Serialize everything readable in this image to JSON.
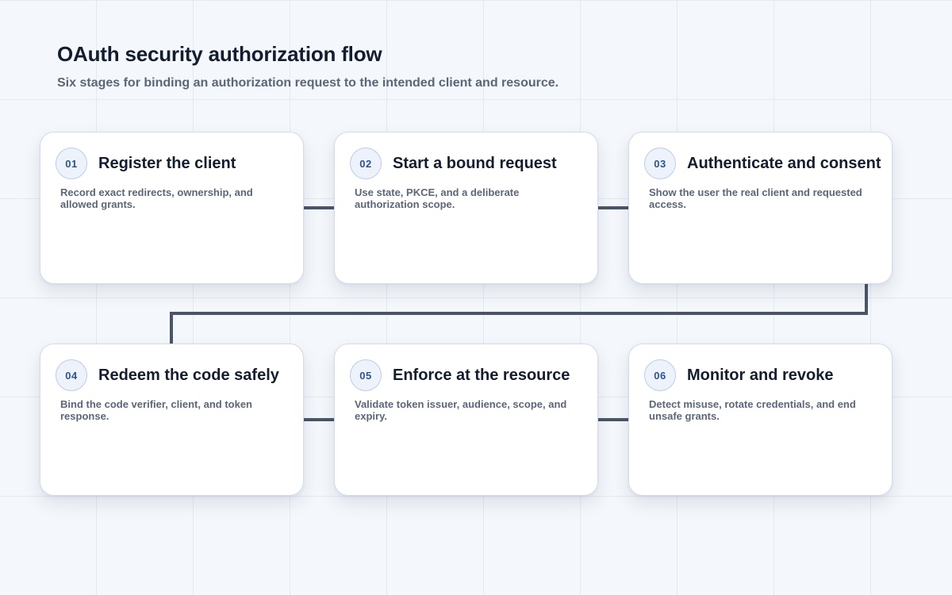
{
  "header": {
    "title": "OAuth security authorization flow",
    "subtitle": "Six stages for binding an authorization request to the intended client and resource."
  },
  "steps": [
    {
      "number": "01",
      "title": "Register the client",
      "description": "Record exact redirects, ownership, and allowed grants."
    },
    {
      "number": "02",
      "title": "Start a bound request",
      "description": "Use state, PKCE, and a deliberate authorization scope."
    },
    {
      "number": "03",
      "title": "Authenticate and consent",
      "description": "Show the user the real client and requested access."
    },
    {
      "number": "04",
      "title": "Redeem the code safely",
      "description": "Bind the code verifier, client, and token response."
    },
    {
      "number": "05",
      "title": "Enforce at the resource",
      "description": "Validate token issuer, audience, scope, and expiry."
    },
    {
      "number": "06",
      "title": "Monitor and revoke",
      "description": "Detect misuse, rotate credentials, and end unsafe grants."
    }
  ],
  "colors": {
    "connector": "#4a5568",
    "badge_text": "#2c5494",
    "title_text": "#141d2e",
    "body_text": "#5b6678"
  }
}
